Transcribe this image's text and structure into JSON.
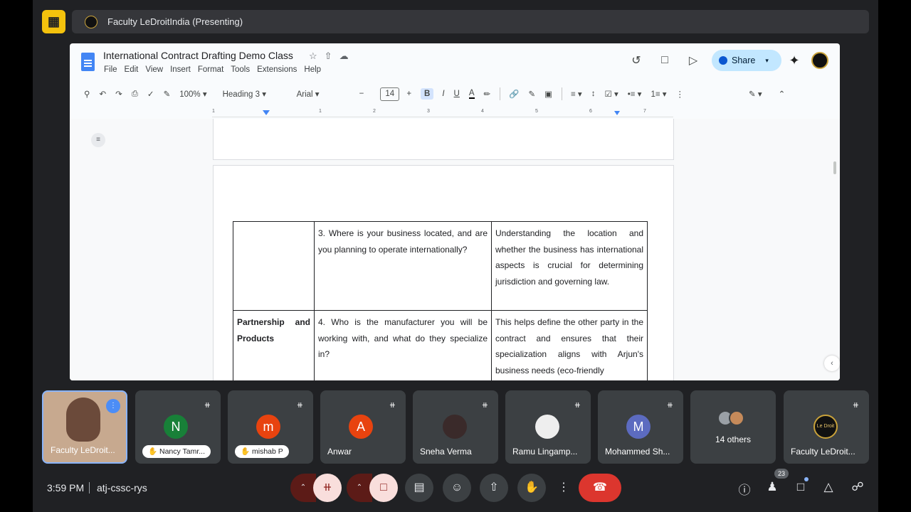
{
  "presentation": {
    "title": "Faculty LeDroitIndia (Presenting)"
  },
  "doc": {
    "title": "International Contract Drafting Demo Class",
    "menu": [
      "File",
      "Edit",
      "View",
      "Insert",
      "Format",
      "Tools",
      "Extensions",
      "Help"
    ],
    "share_label": "Share",
    "toolbar": {
      "zoom": "100%",
      "style": "Heading 3",
      "font": "Arial",
      "font_size": "14",
      "bold": "B",
      "italic": "I",
      "underline": "U",
      "text_color": "A"
    },
    "ruler": [
      "1",
      "1",
      "2",
      "3",
      "4",
      "5",
      "6",
      "7"
    ],
    "table": [
      {
        "col1": "",
        "col2": "3. Where is your business located, and are you planning to operate internationally?",
        "col3": "Understanding the location and whether the business has international aspects is crucial for determining jurisdiction and governing law."
      },
      {
        "col1": "Partnership and Products",
        "col2": "4. Who is the manufacturer you will be working with, and what do they specialize in?",
        "col3": "This helps define the other party in the contract and ensures that their specialization aligns with Arjun's business needs (eco-friendly"
      }
    ]
  },
  "participants": [
    {
      "name": "Faculty LeDroit..."
    },
    {
      "initial": "N",
      "name": "Nancy Tamr...",
      "color": "#188038"
    },
    {
      "initial": "m",
      "name": "mishab P",
      "color": "#e8430f"
    },
    {
      "initial": "A",
      "name": "Anwar",
      "color": "#e8430f"
    },
    {
      "name": "Sneha Verma"
    },
    {
      "name": "Ramu Lingamp..."
    },
    {
      "initial": "M",
      "name": "Mohammed Sh...",
      "color": "#5c6bc0"
    },
    {
      "name": "14 others"
    },
    {
      "name": "Faculty LeDroit...",
      "logo_text": "Le Droit"
    }
  ],
  "meeting": {
    "time": "3:59 PM",
    "code": "atj-cssc-rys",
    "participant_count": "23"
  },
  "colors": {
    "accent": "#8ab4f8",
    "end_call": "#dc362e",
    "share_btn": "#c2e7ff"
  }
}
